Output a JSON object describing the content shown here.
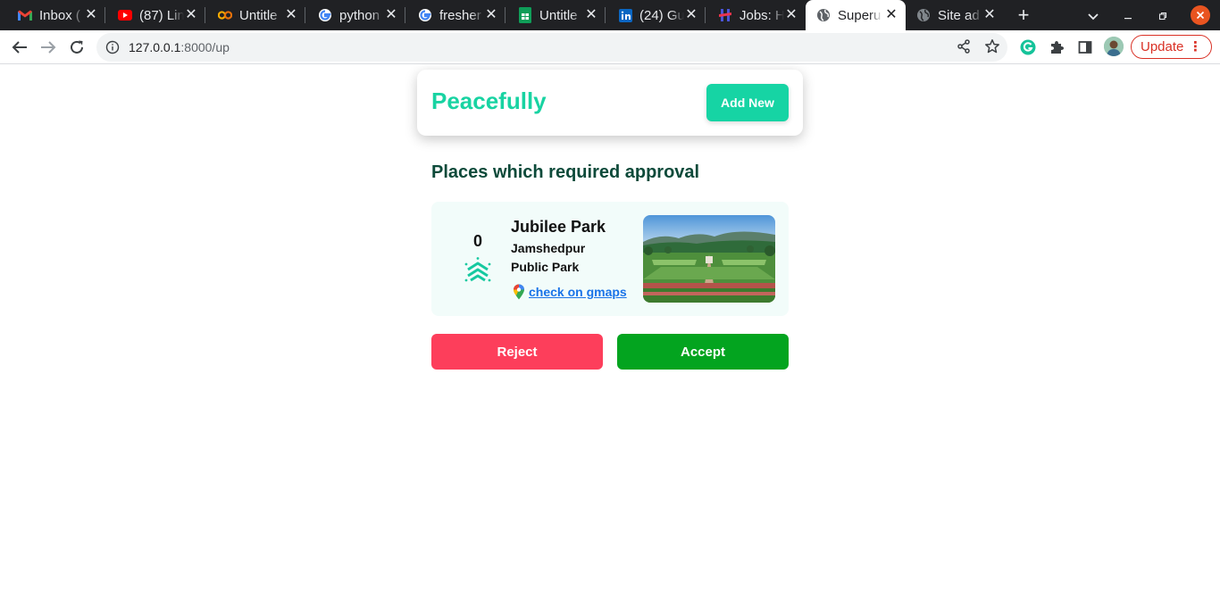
{
  "browser": {
    "tabs": [
      {
        "title": "Inbox (",
        "icon": "gmail-icon",
        "active": false
      },
      {
        "title": "(87) Lin",
        "icon": "youtube-icon",
        "active": false
      },
      {
        "title": "Untitle",
        "icon": "colab-icon",
        "active": false
      },
      {
        "title": "python",
        "icon": "google-icon",
        "active": false
      },
      {
        "title": "fresher",
        "icon": "google-icon",
        "active": false
      },
      {
        "title": "Untitle",
        "icon": "sheets-icon",
        "active": false
      },
      {
        "title": "(24) Gu",
        "icon": "linkedin-icon",
        "active": false
      },
      {
        "title": "Jobs: H",
        "icon": "hack-icon",
        "active": false
      },
      {
        "title": "Superu",
        "icon": "globe-icon",
        "active": true
      },
      {
        "title": "Site ad",
        "icon": "globe-icon",
        "active": false
      }
    ],
    "url_host": "127.0.0.1",
    "url_rest": ":8000/up",
    "update_label": "Update",
    "accent": "#d93025"
  },
  "app": {
    "brand": "Peacefully",
    "add_new_label": "Add New",
    "section_title": "Places which required approval",
    "colors": {
      "brand": "#18d3a2",
      "reject": "#fd3e5b",
      "accept": "#03a41f",
      "card_bg": "#f2fcfa"
    }
  },
  "place": {
    "votes": "0",
    "name": "Jubilee Park",
    "city": "Jamshedpur",
    "type": "Public Park",
    "map_link_label": "check on gmaps"
  },
  "actions": {
    "reject_label": "Reject",
    "accept_label": "Accept"
  }
}
